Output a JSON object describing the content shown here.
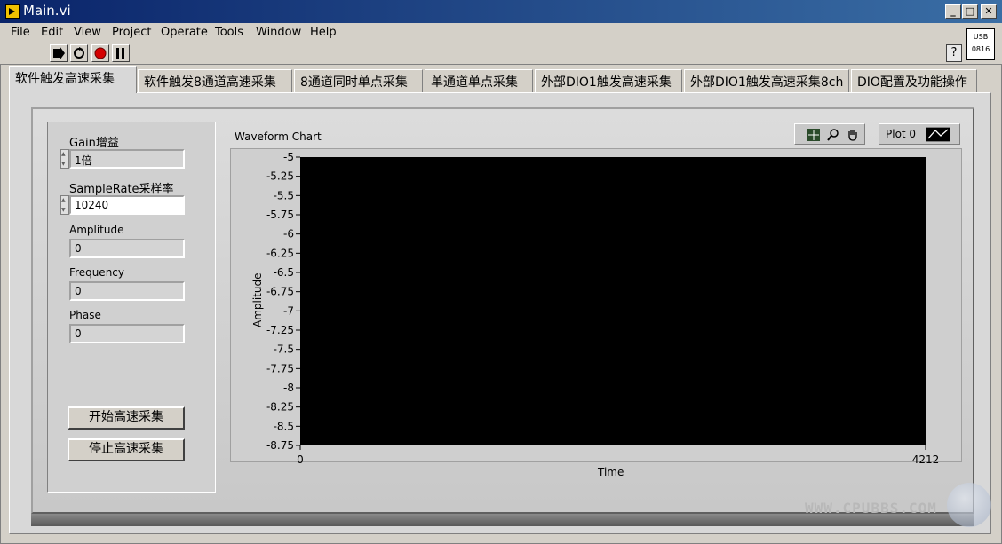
{
  "window": {
    "title": "Main.vi",
    "minimize": "_",
    "maximize": "□",
    "close": "✕"
  },
  "menu": [
    "File",
    "Edit",
    "View",
    "Project",
    "Operate",
    "Tools",
    "Window",
    "Help"
  ],
  "toolbar": {
    "help_symbol": "?",
    "usb_line1": "USB",
    "usb_line2": "0816"
  },
  "tabs": [
    "软件触发高速采集",
    "软件触发8通道高速采集",
    "8通道同时单点采集",
    "单通道单点采集",
    "外部DIO1触发高速采集",
    "外部DIO1触发高速采集8ch",
    "DIO配置及功能操作"
  ],
  "active_tab": 0,
  "controls": {
    "gain_label": "Gain增益",
    "gain_value": "1倍",
    "samplerate_label": "SampleRate采样率",
    "samplerate_value": "10240",
    "amplitude_label": "Amplitude",
    "amplitude_value": "0",
    "frequency_label": "Frequency",
    "frequency_value": "0",
    "phase_label": "Phase",
    "phase_value": "0",
    "start_button": "开始高速采集",
    "stop_button": "停止高速采集"
  },
  "chart_data": {
    "type": "line",
    "title": "Waveform Chart",
    "xlabel": "Time",
    "ylabel": "Amplitude",
    "xlim": [
      0,
      4212
    ],
    "ylim": [
      -8.75,
      -5
    ],
    "x_ticks": [
      "0",
      "4212"
    ],
    "y_ticks": [
      "-5",
      "-5.25",
      "-5.5",
      "-5.75",
      "-6",
      "-6.25",
      "-6.5",
      "-6.75",
      "-7",
      "-7.25",
      "-7.5",
      "-7.75",
      "-8",
      "-8.25",
      "-8.5",
      "-8.75"
    ],
    "series": [
      {
        "name": "Plot 0",
        "x": [],
        "y": []
      }
    ],
    "legend": "top-right",
    "plot_background": "#000000",
    "grid": false
  },
  "watermark": "WWW.CPUBBS.COM"
}
